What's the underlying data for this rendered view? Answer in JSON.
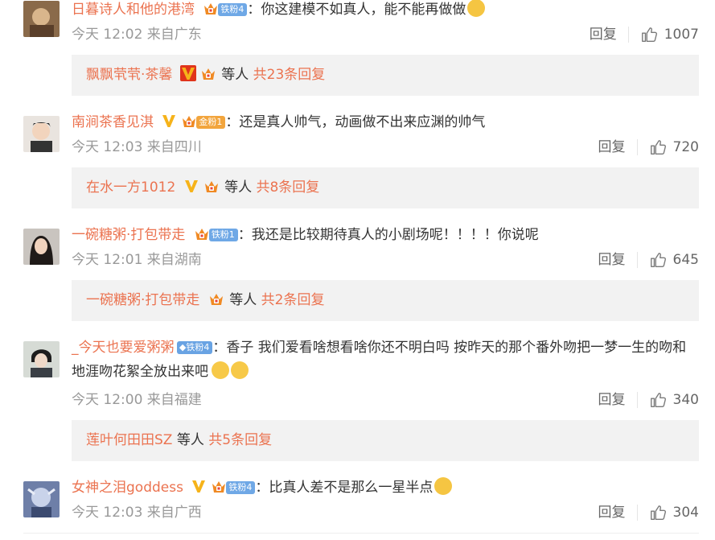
{
  "colors": {
    "accent": "#eb7350",
    "meta": "#999999",
    "sub_bg": "#f2f2f2"
  },
  "comments": [
    {
      "user": "日暮诗人和他的港湾",
      "fan_badge": "铁粉4",
      "text": "：你这建模不如真人，能不能再做做",
      "emoji": "doge-emoji",
      "time_loc": "今天 12:02 来自广东",
      "reply_label": "回复",
      "likes": "1007",
      "sub": {
        "user": "飘飘茕茕·茶馨",
        "etc": "等人",
        "total": "共23条回复"
      }
    },
    {
      "user": "南涧茶香见淇",
      "fan_badge": "金粉1",
      "text": "：还是真人帅气，动画做不出来应渊的帅气",
      "time_loc": "今天 12:03 来自四川",
      "reply_label": "回复",
      "likes": "720",
      "sub": {
        "user": "在水一方1012",
        "etc": "等人",
        "total": "共8条回复"
      }
    },
    {
      "user": "一碗糖粥·打包带走",
      "fan_badge": "铁粉1",
      "text": "：我还是比较期待真人的小剧场呢！！！！你说呢",
      "time_loc": "今天 12:01 来自湖南",
      "reply_label": "回复",
      "likes": "645",
      "sub": {
        "user": "一碗糖粥·打包带走",
        "etc": "等人",
        "total": "共2条回复"
      }
    },
    {
      "user": "_今天也要爱粥粥",
      "fan_badge": "铁粉4",
      "text": "：香子 我们爱看啥想看啥你还不明白吗 按昨天的那个番外吻把一梦一生的吻和地涯吻花絮全放出来吧",
      "time_loc": "今天 12:00 来自福建",
      "reply_label": "回复",
      "likes": "340",
      "sub": {
        "user": "莲叶何田田SZ",
        "etc": "等人",
        "total": "共5条回复"
      }
    },
    {
      "user": "女神之泪goddess",
      "fan_badge": "铁粉4",
      "text": "：比真人差不是那么一星半点",
      "time_loc": "今天 12:03 来自广西",
      "reply_label": "回复",
      "likes": "304"
    }
  ]
}
